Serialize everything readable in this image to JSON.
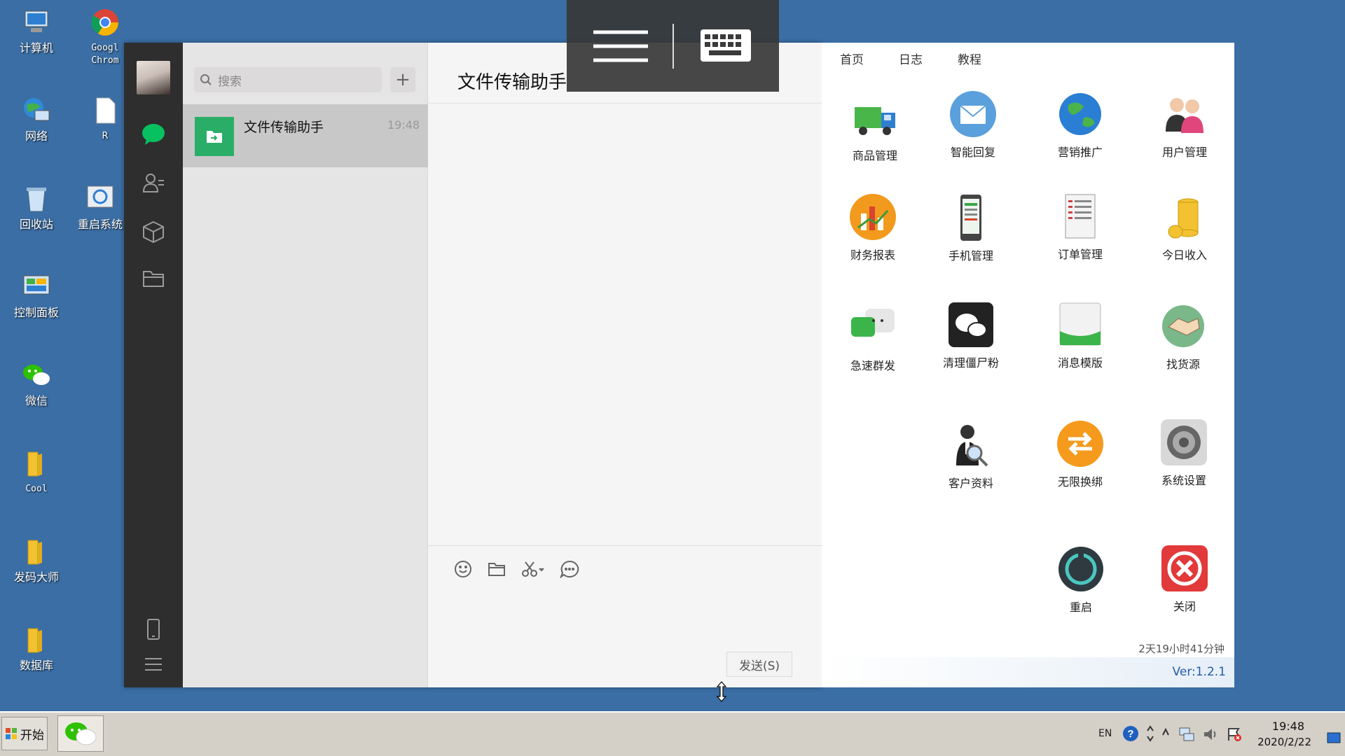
{
  "desktop": {
    "icons": [
      {
        "label": "计算机",
        "icon": "computer-icon"
      },
      {
        "label": "Googl\nChrom",
        "icon": "chrome-icon"
      },
      {
        "label": "网络",
        "icon": "network-icon"
      },
      {
        "label": "R",
        "icon": "file-icon"
      },
      {
        "label": "回收站",
        "icon": "recycle-bin-icon"
      },
      {
        "label": "重启系统",
        "icon": "restart-system-icon"
      },
      {
        "label": "控制面板",
        "icon": "control-panel-icon"
      },
      {
        "label": "微信",
        "icon": "wechat-icon"
      },
      {
        "label": "Cool",
        "icon": "folder-icon"
      },
      {
        "label": "发码大师",
        "icon": "folder-icon"
      },
      {
        "label": "数据库",
        "icon": "folder-icon"
      }
    ]
  },
  "wechat": {
    "search_placeholder": "搜索",
    "add_symbol": "+",
    "chat": {
      "name": "文件传输助手",
      "time": "19:48"
    },
    "chat_title": "文件传输助手",
    "send_label": "发送(S)",
    "close_symbol": "×"
  },
  "panel": {
    "tabs": [
      "首页",
      "日志",
      "教程"
    ],
    "tiles": [
      {
        "label": "商品管理",
        "icon": "truck-icon"
      },
      {
        "label": "智能回复",
        "icon": "mail-icon"
      },
      {
        "label": "营销推广",
        "icon": "globe-icon"
      },
      {
        "label": "用户管理",
        "icon": "users-icon"
      },
      {
        "label": "财务报表",
        "icon": "finance-chart-icon"
      },
      {
        "label": "手机管理",
        "icon": "phone-icon"
      },
      {
        "label": "订单管理",
        "icon": "order-doc-icon"
      },
      {
        "label": "今日收入",
        "icon": "coins-icon"
      },
      {
        "label": "急速群发",
        "icon": "chat-bubbles-icon"
      },
      {
        "label": "清理僵尸粉",
        "icon": "wechat-black-icon"
      },
      {
        "label": "消息模版",
        "icon": "message-template-icon"
      },
      {
        "label": "找货源",
        "icon": "handshake-icon"
      },
      {
        "label": "客户资料",
        "icon": "customer-search-icon"
      },
      {
        "label": "无限换绑",
        "icon": "swap-arrows-icon"
      },
      {
        "label": "系统设置",
        "icon": "settings-icon"
      },
      {
        "label": "重启",
        "icon": "power-icon"
      },
      {
        "label": "关闭",
        "icon": "close-red-icon"
      }
    ],
    "uptime": "2天19小时41分钟",
    "version": "Ver:1.2.1"
  },
  "taskbar": {
    "start_label": "开始",
    "lang": "EN",
    "time": "19:48",
    "date": "2020/2/22"
  }
}
